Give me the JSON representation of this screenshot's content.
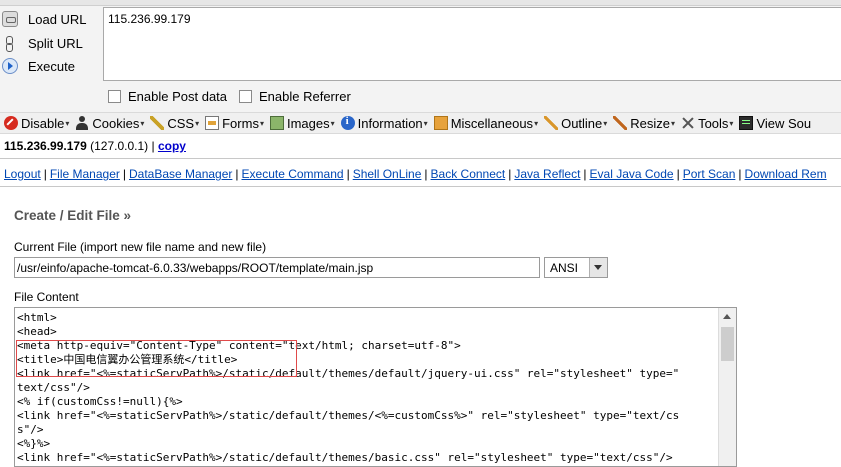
{
  "hackbar": {
    "actions": [
      {
        "label": "Load URL",
        "icon": "load-url-icon"
      },
      {
        "label": "Split URL",
        "icon": "split-url-icon"
      },
      {
        "label": "Execute",
        "icon": "execute-icon"
      }
    ],
    "url_value": "115.236.99.179",
    "enable_post_label": "Enable Post data",
    "enable_referrer_label": "Enable Referrer"
  },
  "toolbar": {
    "items": [
      {
        "label": "Disable",
        "icon": "disable-icon"
      },
      {
        "label": "Cookies",
        "icon": "cookies-icon"
      },
      {
        "label": "CSS",
        "icon": "css-icon"
      },
      {
        "label": "Forms",
        "icon": "forms-icon"
      },
      {
        "label": "Images",
        "icon": "images-icon"
      },
      {
        "label": "Information",
        "icon": "information-icon"
      },
      {
        "label": "Miscellaneous",
        "icon": "miscellaneous-icon"
      },
      {
        "label": "Outline",
        "icon": "outline-icon"
      },
      {
        "label": "Resize",
        "icon": "resize-icon"
      },
      {
        "label": "Tools",
        "icon": "tools-icon"
      },
      {
        "label": "View Sou",
        "icon": "view-source-icon"
      }
    ]
  },
  "host": {
    "ip": "115.236.99.179",
    "local": "(127.0.0.1) |",
    "copy_label": "copy"
  },
  "nav": {
    "links": [
      "Logout",
      "File Manager",
      "DataBase Manager",
      "Execute Command",
      "Shell OnLine",
      "Back Connect",
      "Java Reflect",
      "Eval Java Code",
      "Port Scan",
      "Download Rem"
    ]
  },
  "editor": {
    "title": "Create / Edit File »",
    "current_file_label": "Current File (import new file name and new file)",
    "current_file_value": "/usr/einfo/apache-tomcat-6.0.33/webapps/ROOT/template/main.jsp",
    "encoding_value": "ANSI",
    "content_label": "File Content",
    "code_lines": [
      "<html>",
      "<head>",
      "<meta http-equiv=\"Content-Type\" content=\"text/html; charset=utf-8\">",
      "<title>中国电信翼办公管理系统</title>",
      "<link href=\"<%=staticServPath%>/static/default/themes/default/jquery-ui.css\" rel=\"stylesheet\" type=\"",
      "text/css\"/>",
      "<% if(customCss!=null){%>",
      "<link href=\"<%=staticServPath%>/static/default/themes/<%=customCss%>\" rel=\"stylesheet\" type=\"text/cs",
      "s\"/>",
      "<%}%>",
      "<link href=\"<%=staticServPath%>/static/default/themes/basic.css\" rel=\"stylesheet\" type=\"text/css\"/>"
    ]
  },
  "colors": {
    "link": "#0047b3",
    "highlight_box": "#e04a4a",
    "toolbar_bg": "#f0f0f0"
  }
}
